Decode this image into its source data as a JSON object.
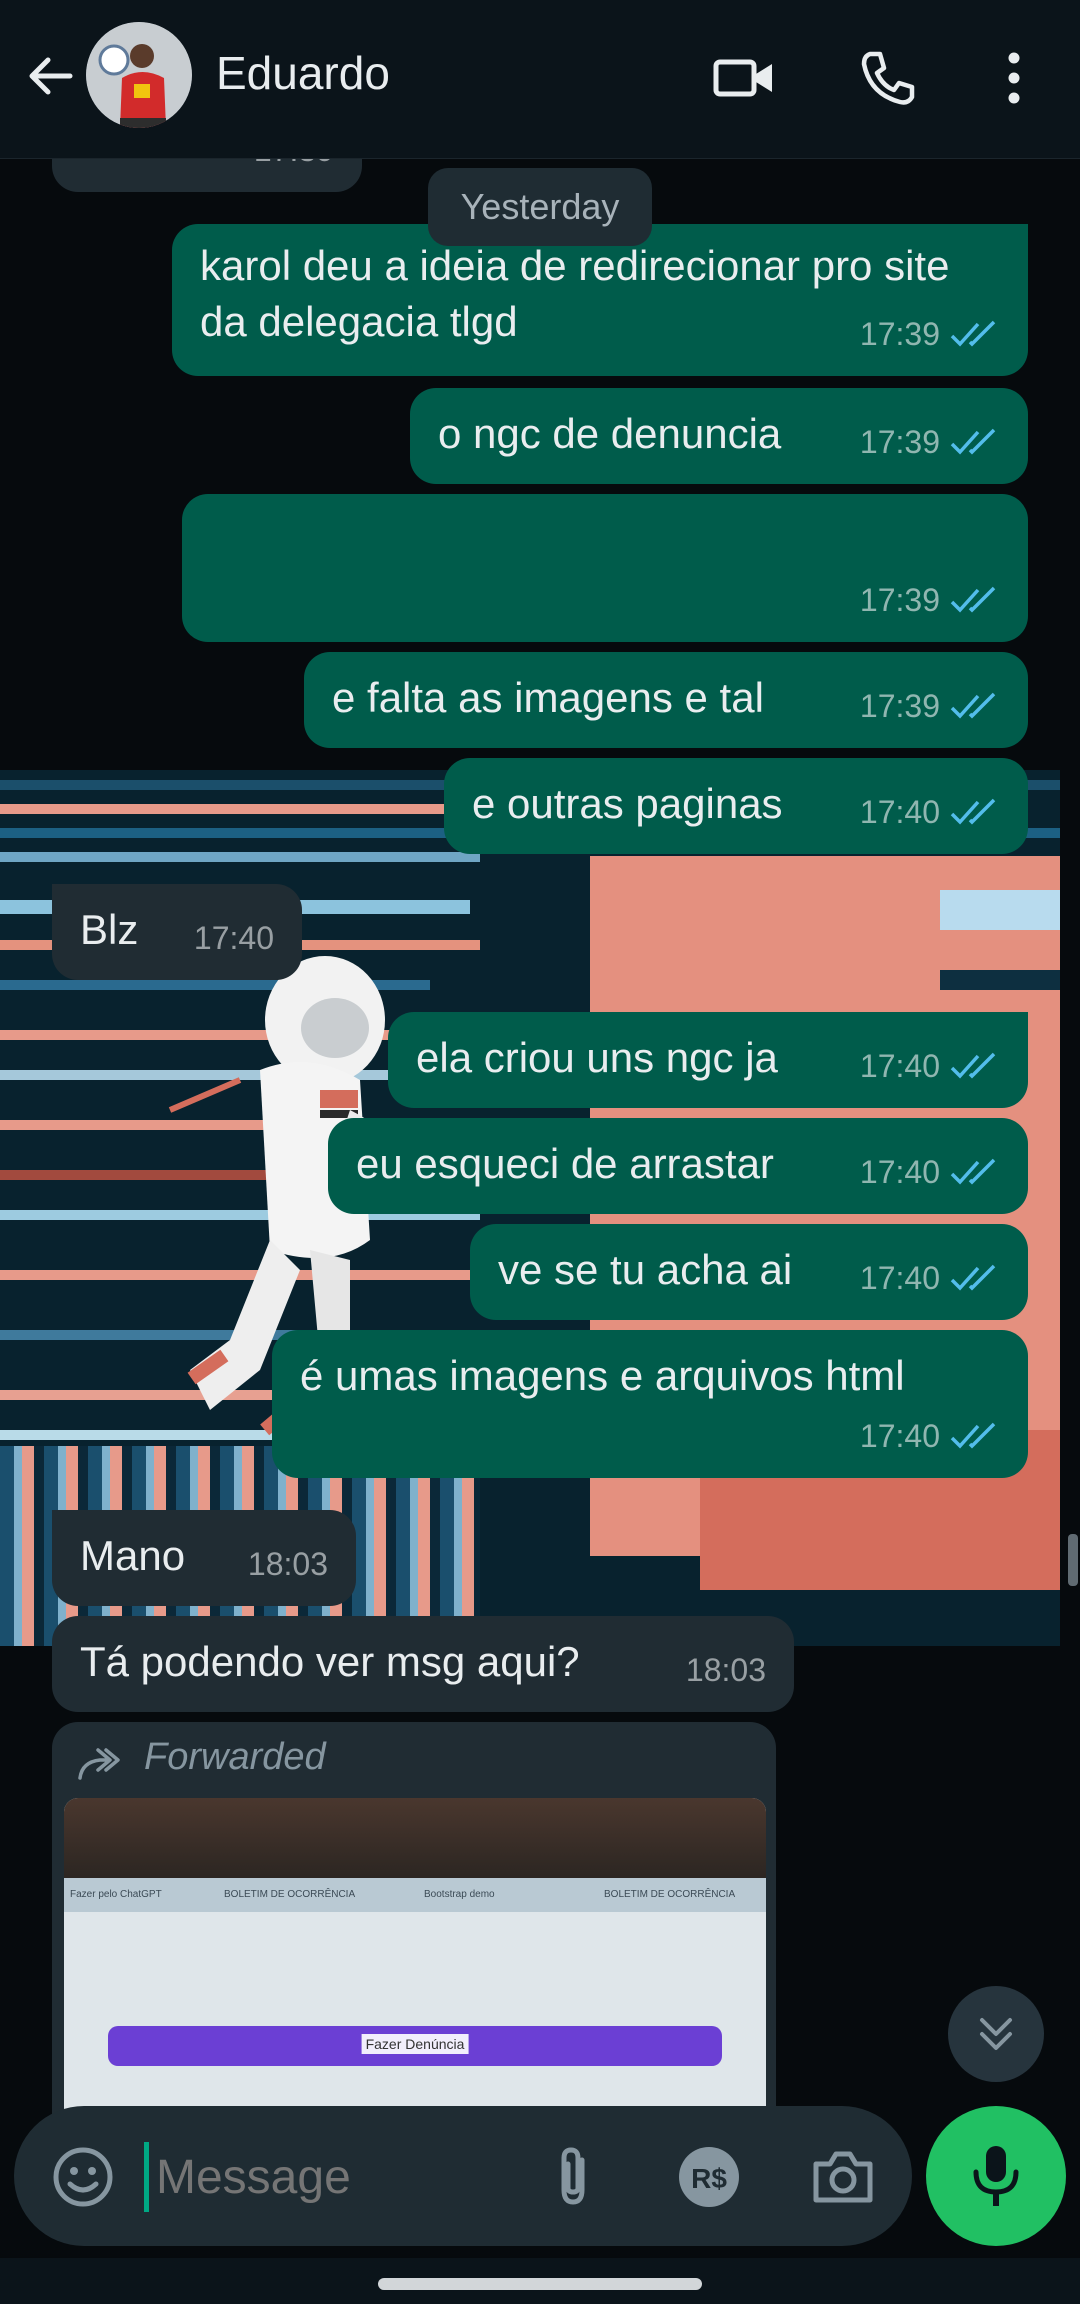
{
  "header": {
    "contact_name": "Eduardo",
    "back_icon": "arrow-back-icon",
    "video_icon": "video-call-icon",
    "call_icon": "phone-icon",
    "menu_icon": "more-vert-icon"
  },
  "prev_time": "17:39",
  "date_chip": "Yesterday",
  "messages": [
    {
      "dir": "out",
      "text": "karol deu a ideia de redirecionar pro site da delegacia tlgd",
      "time": "17:39",
      "status": "read"
    },
    {
      "dir": "out",
      "text": "o ngc de denuncia",
      "time": "17:39",
      "status": "read"
    },
    {
      "dir": "out",
      "text": "",
      "time": "17:39",
      "status": "read"
    },
    {
      "dir": "out",
      "text": "e falta as imagens e tal",
      "time": "17:39",
      "status": "read"
    },
    {
      "dir": "out",
      "text": "e outras paginas",
      "time": "17:40",
      "status": "read"
    },
    {
      "dir": "in",
      "text": "Blz",
      "time": "17:40"
    },
    {
      "dir": "out",
      "text": "ela criou uns ngc ja",
      "time": "17:40",
      "status": "read"
    },
    {
      "dir": "out",
      "text": "eu esqueci de arrastar",
      "time": "17:40",
      "status": "read"
    },
    {
      "dir": "out",
      "text": "ve se tu acha ai",
      "time": "17:40",
      "status": "read"
    },
    {
      "dir": "out",
      "text": "é umas imagens e arquivos html",
      "time": "17:40",
      "status": "read"
    },
    {
      "dir": "in",
      "text": "Mano",
      "time": "18:03"
    },
    {
      "dir": "in",
      "text": "Tá podendo ver msg aqui?",
      "time": "18:03"
    }
  ],
  "forwarded": {
    "label": "Forwarded",
    "icon": "forward-icon",
    "screenshot_tabs": [
      "Fazer pelo ChatGPT",
      "BOLETIM DE OCORRÊNCIA",
      "Bootstrap demo",
      "BOLETIM DE OCORRÊNCIA"
    ],
    "screenshot_button": "Fazer Denúncia"
  },
  "composer": {
    "placeholder": "Message",
    "emoji_icon": "emoji-icon",
    "attach_icon": "paperclip-icon",
    "payment_icon": "rs-payment-icon",
    "camera_icon": "camera-icon",
    "mic_icon": "microphone-icon"
  },
  "colors": {
    "outgoing_bubble": "#005c4b",
    "incoming_bubble": "#202c33",
    "read_ticks": "#53bdeb",
    "mic_button": "#21c063"
  }
}
